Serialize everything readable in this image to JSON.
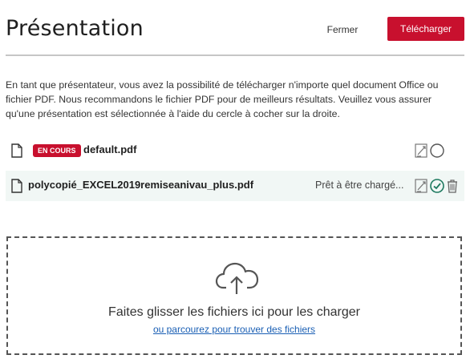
{
  "header": {
    "title": "Présentation",
    "close_label": "Fermer",
    "upload_label": "Télécharger"
  },
  "description": "En tant que présentateur, vous avez la possibilité de télécharger n'importe quel document Office ou fichier PDF. Nous recommandons le fichier PDF pour de meilleurs résultats. Veuillez vous assurer qu'une présentation est sélectionnée à l'aide du cercle à cocher sur la droite.",
  "files": [
    {
      "badge": "EN COURS",
      "name": "default.pdf",
      "status": "",
      "selected": false,
      "icons": [
        "file-icon",
        "download-toggle-icon",
        "select-circle-icon"
      ]
    },
    {
      "badge": "",
      "name": "polycopié_EXCEL2019remiseanivau_plus.pdf",
      "status": "Prêt à être chargé...",
      "selected": true,
      "icons": [
        "file-icon",
        "download-toggle-icon",
        "check-circle-icon",
        "trash-icon"
      ]
    }
  ],
  "dropzone": {
    "icon": "cloud-upload-icon",
    "text": "Faites glisser les fichiers ici pour les charger",
    "browse_link": "ou parcourez pour trouver des fichiers"
  },
  "colors": {
    "accent": "#c8102e",
    "success": "#1e7a5f",
    "link": "#1a5fb4",
    "row_highlight": "#f1f7f5"
  }
}
